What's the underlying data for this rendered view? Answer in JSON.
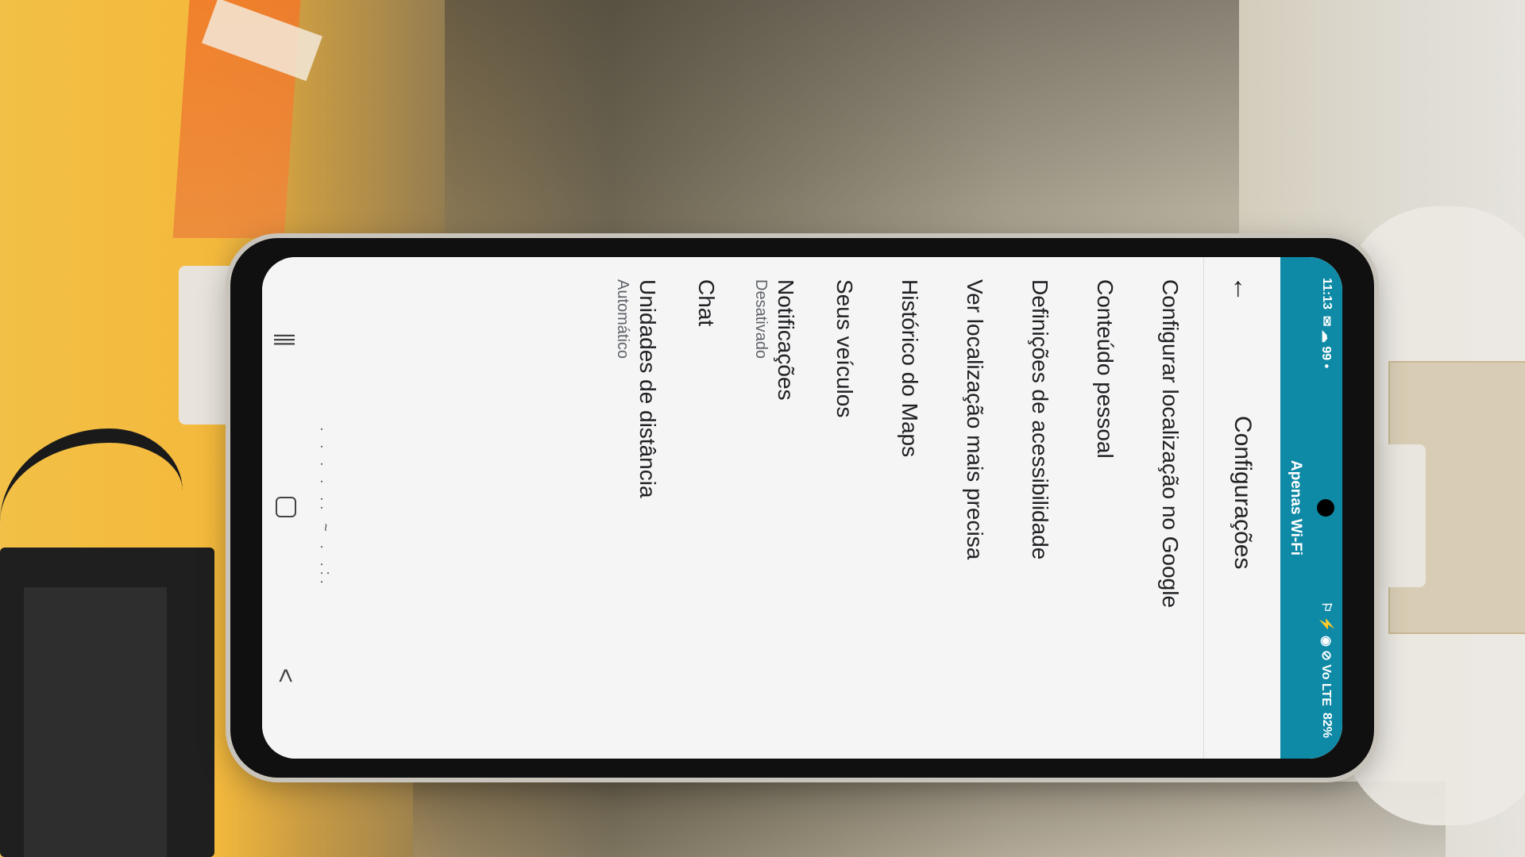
{
  "status_bar": {
    "time": "11:13",
    "left_icons": "✉ ☁ 99 •",
    "right_icons": "⚐ ⚡ ◉ ⊘ Vo LTE",
    "battery": "82%"
  },
  "banner": {
    "text": "Apenas Wi-Fi"
  },
  "app_bar": {
    "back_symbol": "←",
    "title": "Configurações"
  },
  "settings": {
    "items": [
      {
        "label": "Configurar localização no Google",
        "sub": ""
      },
      {
        "label": "Conteúdo pessoal",
        "sub": ""
      },
      {
        "label": "Definições de acessibilidade",
        "sub": ""
      },
      {
        "label": "Ver localização mais precisa",
        "sub": ""
      },
      {
        "label": "Histórico do Maps",
        "sub": ""
      },
      {
        "label": "Seus veículos",
        "sub": ""
      },
      {
        "label": "Notificações",
        "sub": "Desativado"
      },
      {
        "label": "Chat",
        "sub": ""
      },
      {
        "label": "Unidades de distância",
        "sub": "Automático"
      }
    ]
  },
  "keyboard_hint": ". . .   .  ..  ~  .  .:.",
  "nav_bar": {
    "recent": "|||",
    "back": "<"
  },
  "colors": {
    "accent": "#0f8aa6",
    "screen_bg": "#f5f5f5"
  },
  "icons": [
    "back-arrow-icon",
    "mail-icon",
    "cloud-icon",
    "signal-icon",
    "wifi-icon",
    "battery-icon",
    "recent-apps-icon",
    "home-icon",
    "back-icon"
  ]
}
